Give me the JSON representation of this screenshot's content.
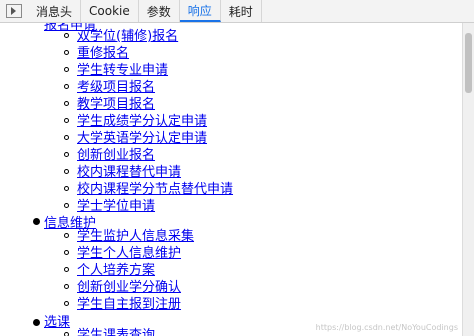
{
  "tabs": [
    {
      "label": "消息头"
    },
    {
      "label": "Cookie"
    },
    {
      "label": "参数"
    },
    {
      "label": "响应",
      "active": true
    },
    {
      "label": "耗时"
    }
  ],
  "top_partial_label": "报名申请",
  "section_a": {
    "items": [
      "双学位(辅修)报名",
      "重修报名",
      "学生转专业申请",
      "考级项目报名",
      "教学项目报名",
      "学生成绩学分认定申请",
      "大学英语学分认定申请",
      "创新创业报名",
      "校内课程替代申请",
      "校内课程学分节点替代申请",
      "学士学位申请"
    ]
  },
  "section_b": {
    "label": "信息维护",
    "items": [
      "学生监护人信息采集",
      "学生个人信息维护",
      "个人培养方案",
      "创新创业学分确认",
      "学生自主报到注册"
    ]
  },
  "section_c": {
    "label": "选课",
    "items": [
      "学生课表查询"
    ]
  },
  "watermark": "https://blog.csdn.net/NoYouCodings"
}
